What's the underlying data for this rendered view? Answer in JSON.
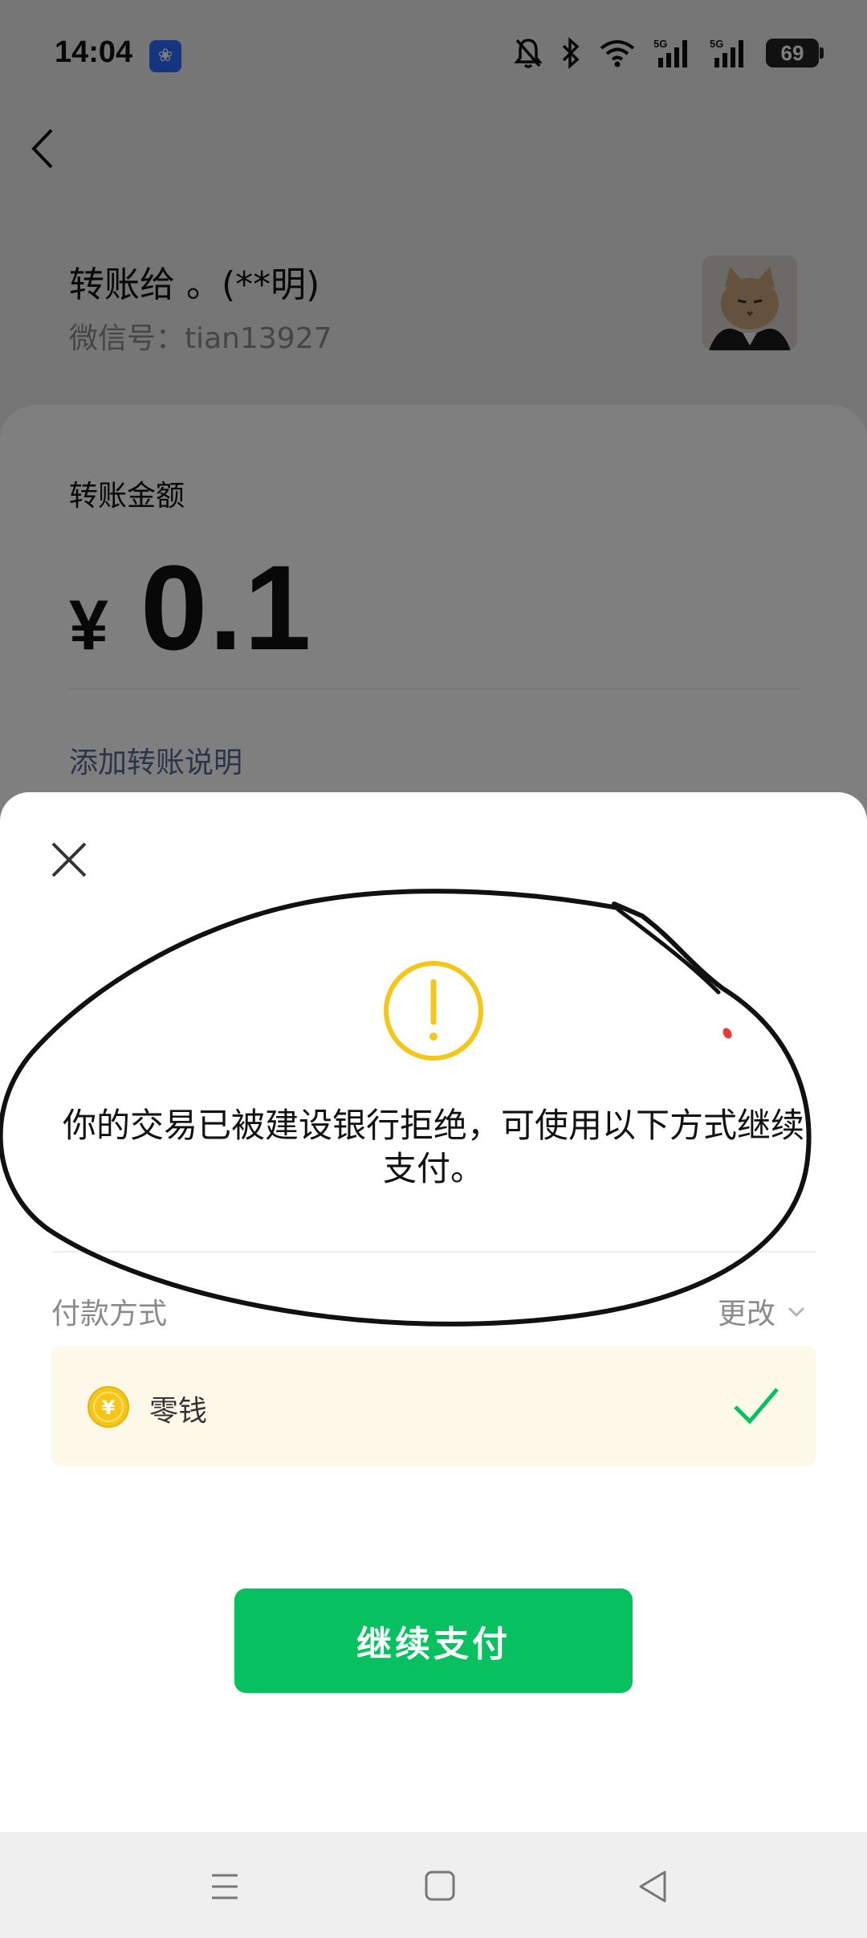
{
  "status_bar": {
    "time": "14:04",
    "app_icon": "baidu-paw-icon",
    "battery": "69",
    "icons": [
      "bell-muted-icon",
      "bluetooth-icon",
      "wifi-icon",
      "signal-5g-icon",
      "signal-5g-icon",
      "battery-icon"
    ]
  },
  "header": {
    "back_icon": "chevron-left-icon"
  },
  "payee": {
    "title": "转账给 。(**明)",
    "wechat_id": "微信号：tian13927",
    "avatar_icon": "cat-avatar"
  },
  "amount": {
    "label": "转账金额",
    "currency": "¥",
    "value": "0.1",
    "add_note": "添加转账说明"
  },
  "sheet": {
    "close_icon": "close-icon",
    "warning_icon": "exclamation-circle-icon",
    "message": "你的交易已被建设银行拒绝，可使用以下方式继续支付。",
    "payment_method_label": "付款方式",
    "change_label": "更改",
    "method": {
      "name": "零钱",
      "icon": "yuan-coin-icon",
      "selected": true
    },
    "continue_button": "继续支付"
  },
  "colors": {
    "primary_green": "#07c160",
    "warning_yellow": "#f5c518",
    "link_blue": "#576b95",
    "method_bg": "#fdf8e8"
  },
  "nav_bar": {
    "icons": [
      "menu-icon",
      "home-square-icon",
      "back-triangle-icon"
    ]
  }
}
